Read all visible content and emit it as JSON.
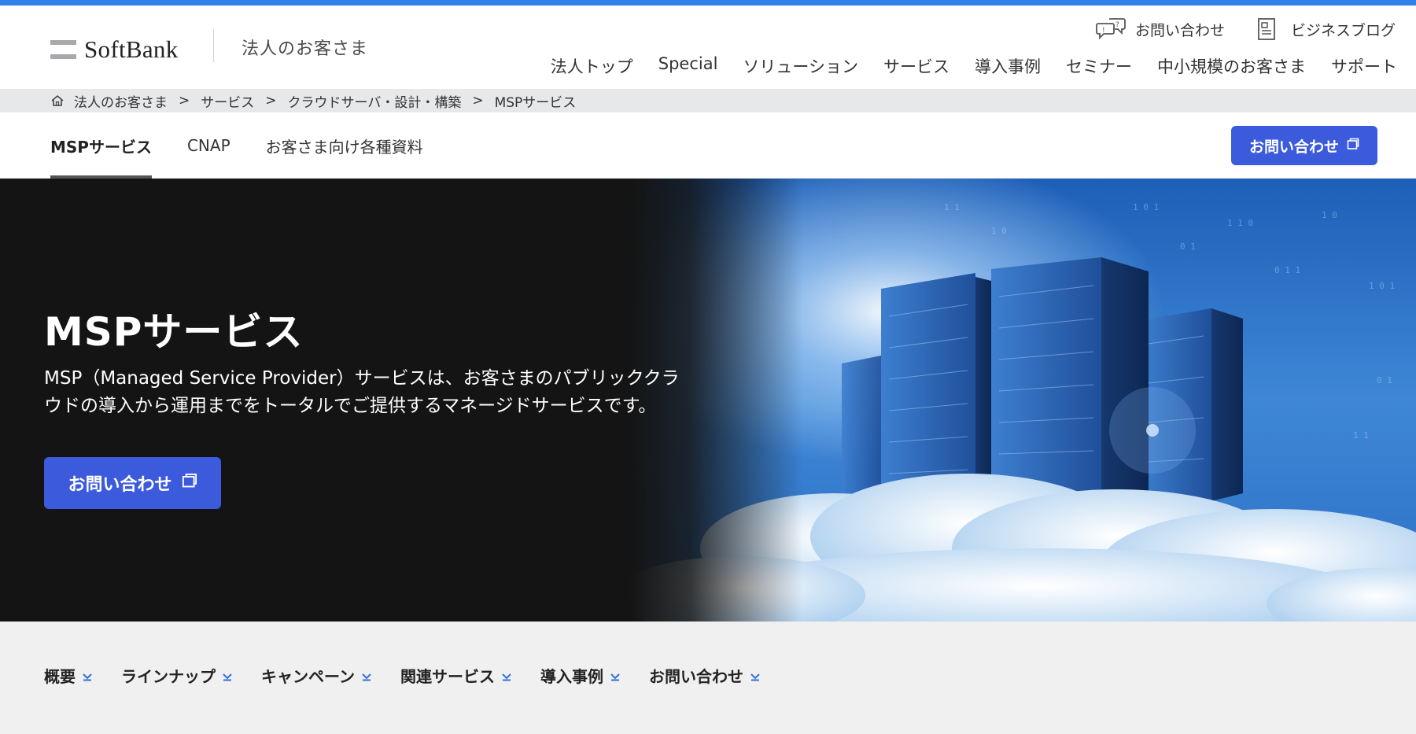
{
  "colors": {
    "accent": "#3c5bdc",
    "top_strip": "#2f80e8",
    "breadcrumb_bg": "#e6e8ea",
    "hero_bg": "#141414",
    "anchor_bg": "#f0f0f0"
  },
  "header": {
    "logo_text": "SoftBank",
    "logo_sub": "法人のお客さま",
    "util_links": [
      {
        "label": "お問い合わせ",
        "icon": "chat-bubbles-icon"
      },
      {
        "label": "ビジネスブログ",
        "icon": "document-icon"
      }
    ],
    "nav": [
      "法人トップ",
      "Special",
      "ソリューション",
      "サービス",
      "導入事例",
      "セミナー",
      "中小規模のお客さま",
      "サポート"
    ]
  },
  "breadcrumb": {
    "home_icon": "home-icon",
    "items": [
      "法人のお客さま",
      "サービス",
      "クラウドサーバ・設計・構築",
      "MSPサービス"
    ],
    "separator": ">"
  },
  "subnav": {
    "tabs": [
      "MSPサービス",
      "CNAP",
      "お客さま向け各種資料"
    ],
    "active_index": 0,
    "contact_label": "お問い合わせ",
    "contact_icon": "external-window-icon"
  },
  "hero": {
    "title": "MSPサービス",
    "description": "MSP（Managed Service Provider）サービスは、お客さまのパブリッククラウドの導入から運用までをトータルでご提供するマネージドサービスです。",
    "button_label": "お問い合わせ",
    "button_icon": "external-window-icon"
  },
  "anchors": [
    "概要",
    "ラインナップ",
    "キャンペーン",
    "関連サービス",
    "導入事例",
    "お問い合わせ"
  ]
}
